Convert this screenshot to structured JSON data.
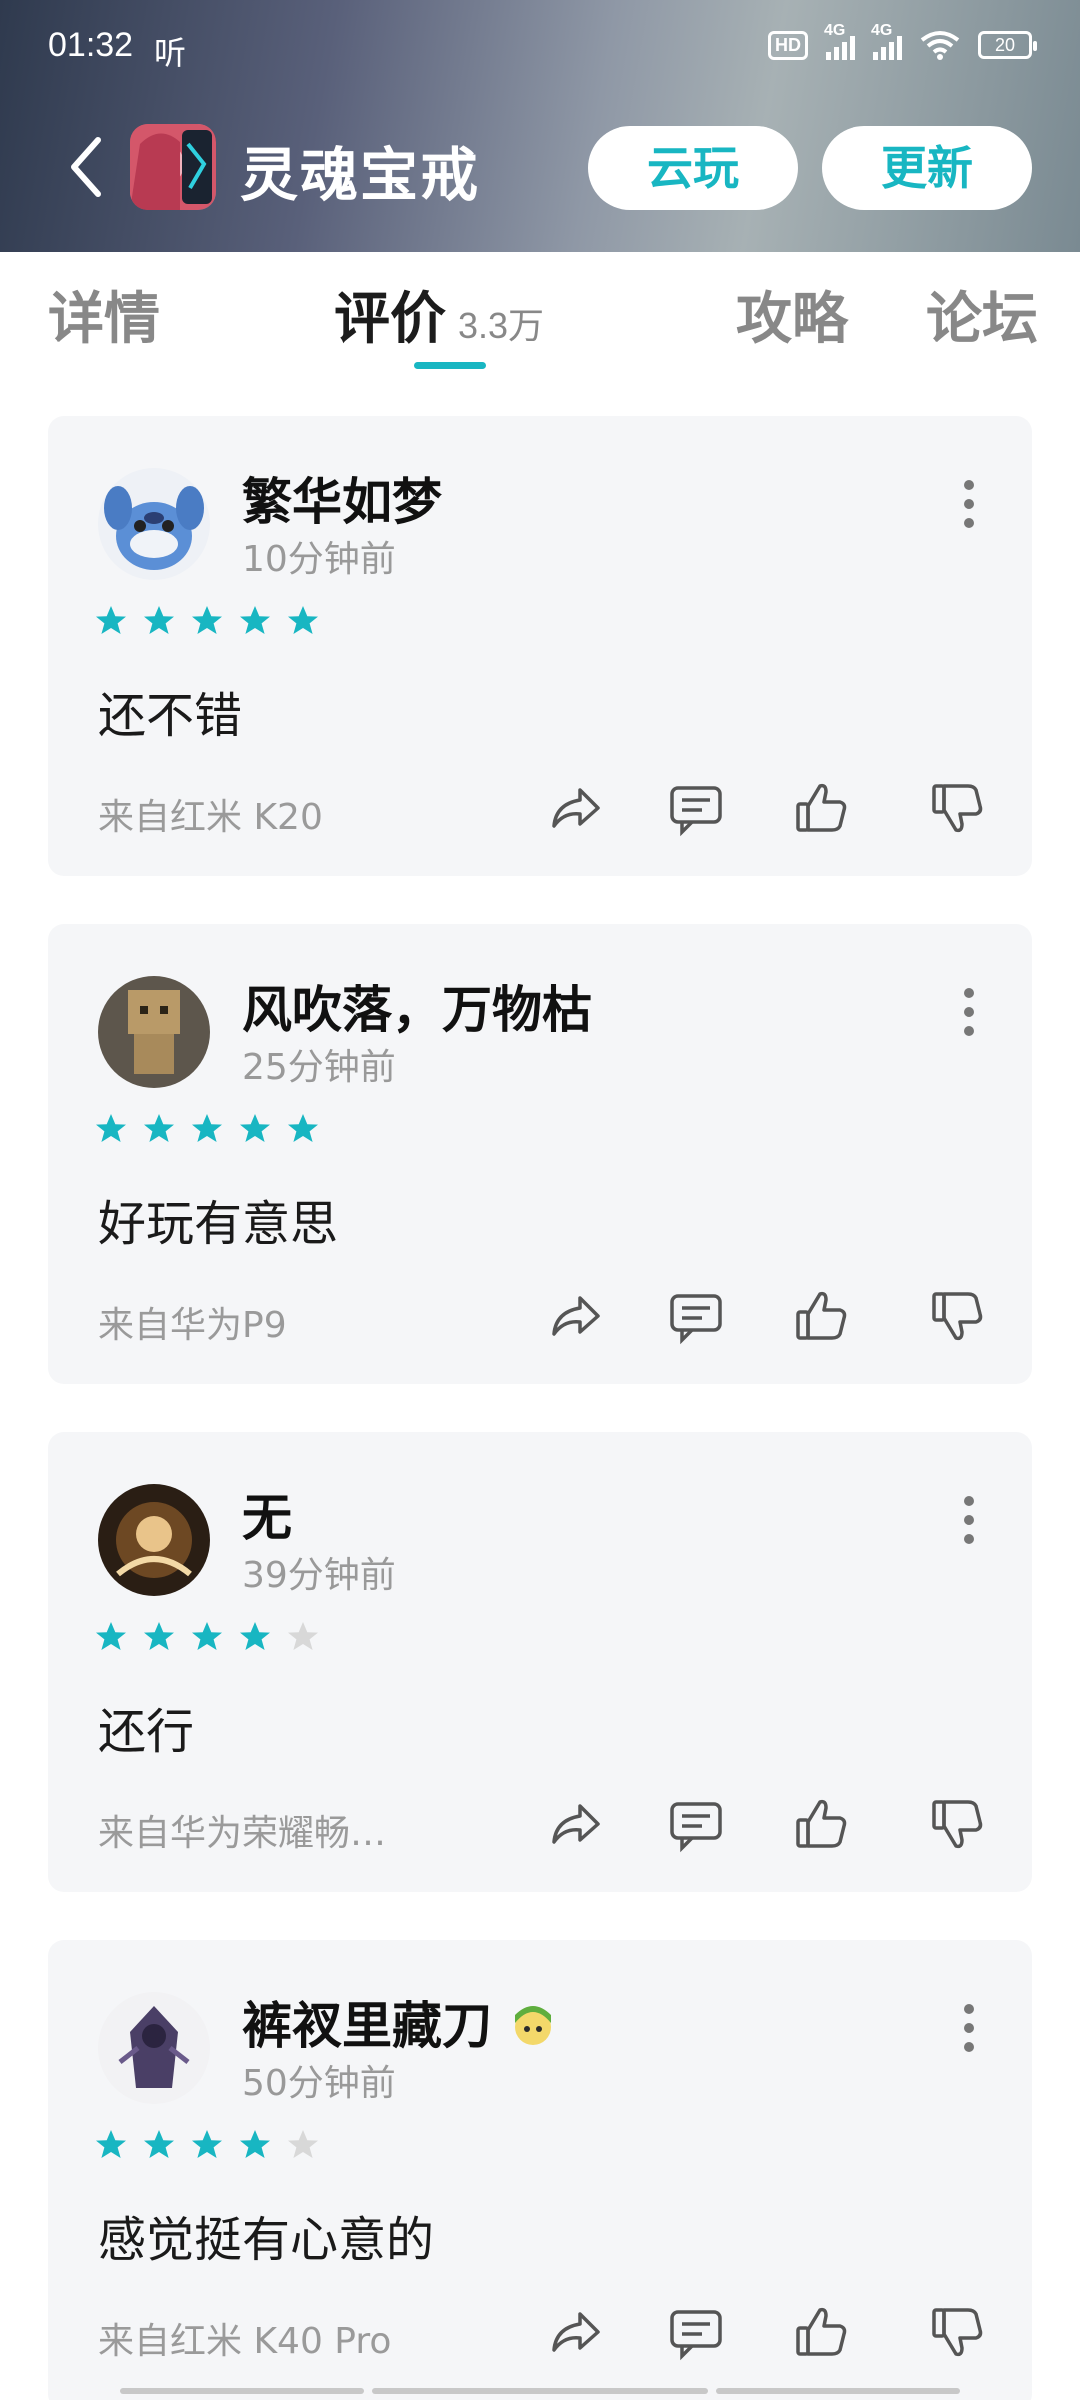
{
  "status_bar": {
    "time": "01:32",
    "carrier_label": "听",
    "hd_label": "HD",
    "net1": "4G",
    "net2": "4G",
    "battery": "20"
  },
  "header": {
    "app_title": "灵魂宝戒",
    "cloud_play_label": "云玩",
    "update_label": "更新"
  },
  "tabs": [
    {
      "label": "详情",
      "count": ""
    },
    {
      "label": "评价",
      "count": "3.3万"
    },
    {
      "label": "攻略",
      "count": ""
    },
    {
      "label": "论坛",
      "count": ""
    }
  ],
  "active_tab": "评价",
  "colors": {
    "accent": "#18b6c2",
    "star_off": "#d8d8d8",
    "card_bg": "#f5f6f8"
  },
  "reviews": [
    {
      "user": "繁华如梦",
      "time": "10分钟前",
      "rating": 5,
      "content": "还不错",
      "device": "来自红米 K20"
    },
    {
      "user": "风吹落，万物枯",
      "time": "25分钟前",
      "rating": 5,
      "content": "好玩有意思",
      "device": "来自华为P9"
    },
    {
      "user": "无",
      "time": "39分钟前",
      "rating": 4,
      "content": "还行",
      "device": "来自华为荣耀畅…"
    },
    {
      "user": "裤衩里藏刀",
      "time": "50分钟前",
      "rating": 4,
      "content": "感觉挺有心意的",
      "device": "来自红米 K40 Pro"
    }
  ]
}
